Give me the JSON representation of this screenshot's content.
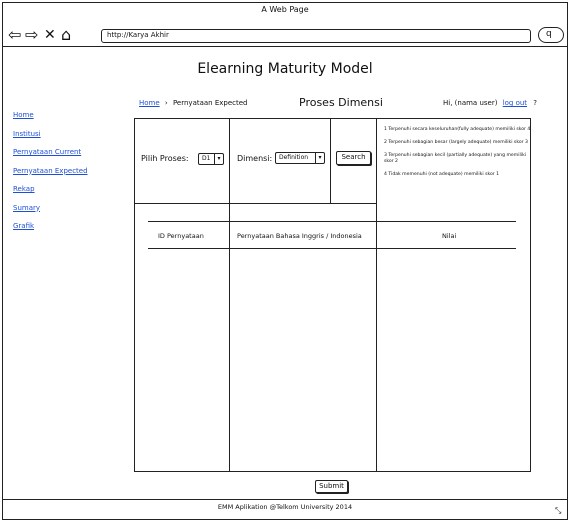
{
  "window": {
    "title": "A Web Page",
    "address": "http://Karya Akhir",
    "search_icon": "magnifier-icon"
  },
  "page": {
    "title": "Elearning Maturity Model"
  },
  "sidebar": {
    "items": [
      {
        "label": "Home"
      },
      {
        "label": "Institusi"
      },
      {
        "label": "Pernyataan Current"
      },
      {
        "label": "Pernyataan Expected"
      },
      {
        "label": "Rekap"
      },
      {
        "label": "Sumary"
      },
      {
        "label": "Grafik"
      }
    ]
  },
  "breadcrumb": {
    "home": "Home",
    "separator": "›",
    "current": "Pernyataan Expected"
  },
  "section": {
    "title": "Proses Dimensi"
  },
  "user": {
    "greeting": "Hi, (nama user)",
    "logout": "log out",
    "help": "?"
  },
  "filters": {
    "proses_label": "Pilih Proses:",
    "proses_value": "D1",
    "dimensi_label": "Dimensi:",
    "dimensi_value": "Definition",
    "search_label": "Search"
  },
  "legend": [
    "1 Terpenuhi secara keseluruhan(fully adequate) memiliki skor 4",
    "2 Terpenuhi sebagian besar (largely adequate) memiliki skor 3",
    "3 Terpenuhi sebagian kecil (partially adequate) yang memiliki skor 2",
    "4 Tidak memenuhi (not adequate) memiliki skor 1"
  ],
  "table": {
    "columns": [
      "ID Pernyataan",
      "Pernyataan Bahasa Inggris / Indonesia",
      "Nilai"
    ]
  },
  "actions": {
    "submit_label": "Submit"
  },
  "footer": {
    "text": "EMM Aplikation @Telkom University 2014"
  }
}
